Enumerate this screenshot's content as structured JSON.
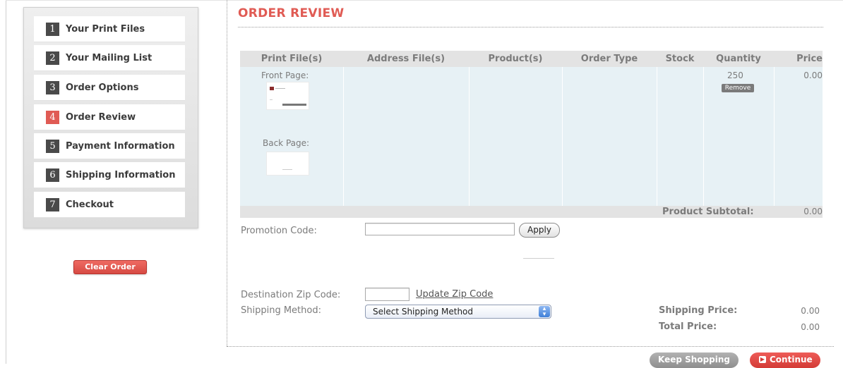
{
  "sidebar": {
    "steps": [
      {
        "num": "1",
        "label": "Your Print Files"
      },
      {
        "num": "2",
        "label": "Your Mailing List"
      },
      {
        "num": "3",
        "label": "Order Options"
      },
      {
        "num": "4",
        "label": "Order Review",
        "active": true
      },
      {
        "num": "5",
        "label": "Payment Information"
      },
      {
        "num": "6",
        "label": "Shipping Information"
      },
      {
        "num": "7",
        "label": "Checkout"
      }
    ],
    "clear_order_label": "Clear Order"
  },
  "main": {
    "title": "ORDER REVIEW",
    "table": {
      "headers": [
        "Print File(s)",
        "Address File(s)",
        "Product(s)",
        "Order Type",
        "Stock",
        "Quantity",
        "Price"
      ],
      "front_page_label": "Front Page:",
      "back_page_label": "Back Page:",
      "quantity": "250",
      "remove_label": "Remove",
      "price": "0.00",
      "subtotal_label": "Product Subtotal:",
      "subtotal_value": "0.00"
    },
    "promotion": {
      "label": "Promotion Code:",
      "value": "",
      "apply_label": "Apply"
    },
    "shipping": {
      "zip_label": "Destination Zip Code:",
      "zip_value": "",
      "update_zip_label": "Update Zip Code",
      "method_label": "Shipping Method:",
      "method_selected": "Select Shipping Method",
      "shipping_price_label": "Shipping Price:",
      "shipping_price_value": "0.00",
      "total_price_label": "Total Price:",
      "total_price_value": "0.00"
    },
    "buttons": {
      "keep_shopping": "Keep Shopping",
      "continue": "Continue"
    }
  },
  "colors": {
    "accent": "#e05b54",
    "table_body": "#e7f1f5",
    "table_header": "#e3e3e3"
  }
}
